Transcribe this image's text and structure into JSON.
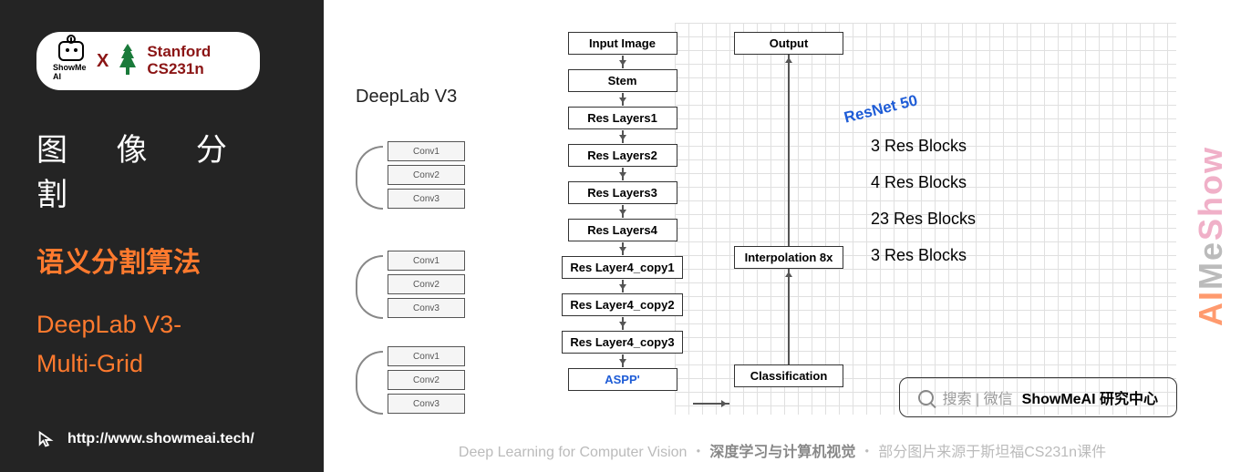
{
  "badge": {
    "brand": "ShowMe AI",
    "x": "X",
    "stanford1": "Stanford",
    "stanford2": "CS231n"
  },
  "left": {
    "title1": "图 像 分 割",
    "title2": "语义分割算法",
    "title3a": "DeepLab V3-",
    "title3b": "Multi-Grid",
    "url": "http://www.showmeai.tech/"
  },
  "diagram": {
    "title": "DeepLab V3",
    "multigrid": [
      "Conv1",
      "Conv2",
      "Conv3"
    ],
    "flow": [
      "Input Image",
      "Stem",
      "Res Layers1",
      "Res Layers2",
      "Res Layers3",
      "Res Layers4",
      "Res Layer4_copy1",
      "Res Layer4_copy2",
      "Res Layer4_copy3",
      "ASPP'"
    ],
    "right_flow": {
      "output": "Output",
      "interp": "Interpolation 8x",
      "class": "Classification"
    },
    "resnet": "ResNet 50",
    "blocks": [
      "3 Res Blocks",
      "4 Res Blocks",
      "23 Res Blocks",
      "3 Res Blocks"
    ]
  },
  "watermark": {
    "p1": "Show",
    "p2": "Me",
    "p3": "AI"
  },
  "search": {
    "hint": "搜索 | 微信",
    "bold": "ShowMeAI 研究中心"
  },
  "footer": {
    "p1": "Deep Learning for Computer Vision ・ ",
    "p2": "深度学习与计算机视觉",
    "p3": " ・ 部分图片来源于斯坦福CS231n课件"
  }
}
